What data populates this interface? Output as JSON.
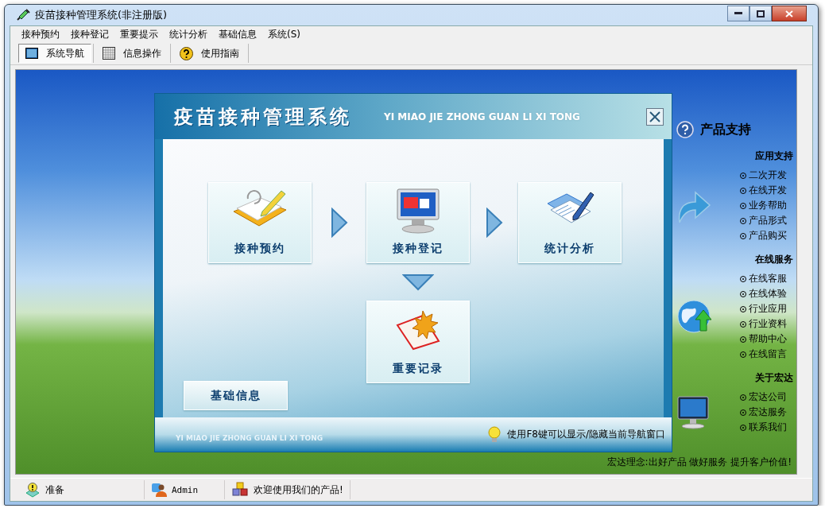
{
  "window": {
    "title": "疫苗接种管理系统(非注册版)"
  },
  "menu": [
    "接种预约",
    "接种登记",
    "重要提示",
    "统计分析",
    "基础信息",
    "系统(S)"
  ],
  "toolbar": [
    {
      "label": "系统导航",
      "selected": true
    },
    {
      "label": "信息操作",
      "selected": false
    },
    {
      "label": "使用指南",
      "selected": false
    }
  ],
  "navigator": {
    "title": "疫苗接种管理系统",
    "subtitle": "YI MIAO JIE ZHONG GUAN LI XI TONG",
    "modules": [
      "接种预约",
      "接种登记",
      "统计分析",
      "重要记录"
    ],
    "basic_button": "基础信息",
    "footer_left": "YI MIAO JIE ZHONG GUAN LI XI TONG",
    "hint": "使用F8键可以显示/隐藏当前导航窗口"
  },
  "support": {
    "title": "产品支持",
    "sections": [
      {
        "heading": "应用支持",
        "links": [
          "二次开发",
          "在线开发",
          "业务帮助",
          "产品形式",
          "产品购买"
        ]
      },
      {
        "heading": "在线服务",
        "links": [
          "在线客服",
          "在线体验",
          "行业应用",
          "行业资料",
          "帮助中心",
          "在线留言"
        ]
      },
      {
        "heading": "关于宏达",
        "links": [
          "宏达公司",
          "宏达服务",
          "联系我们"
        ]
      }
    ],
    "slogan": "宏达理念:出好产品 做好服务 提升客户价值!"
  },
  "status_bar": [
    "准备",
    "Admin",
    "欢迎使用我们的产品!"
  ]
}
